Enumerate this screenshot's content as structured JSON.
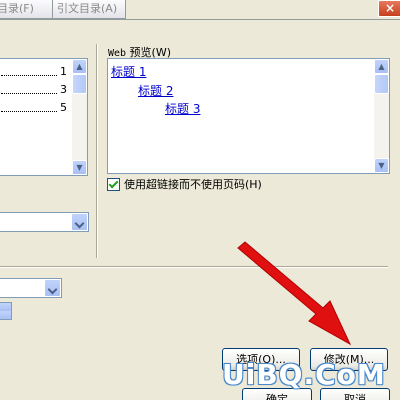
{
  "tabs": [
    {
      "label": "目录(F)"
    },
    {
      "label": "引文目录(A)"
    }
  ],
  "print_preview": {
    "page_numbers": [
      "1",
      "3",
      "5"
    ]
  },
  "web_preview": {
    "label_prefix": "Web",
    "label_text": " 预览(W)",
    "headings": [
      "标题 1",
      "标题 2",
      "标题 3"
    ]
  },
  "hyperlink_option": {
    "label": "使用超链接而不使用页码(H)",
    "checked": true
  },
  "buttons": {
    "options": "选项(O)...",
    "modify": "修改(M)...",
    "ok": "确定",
    "cancel": "取消"
  },
  "close_glyph": "×",
  "watermark": "UiBQ.CoM",
  "colors": {
    "link": "#0000cc",
    "annotation_arrow": "#e01010",
    "checkmark": "#21a121"
  }
}
